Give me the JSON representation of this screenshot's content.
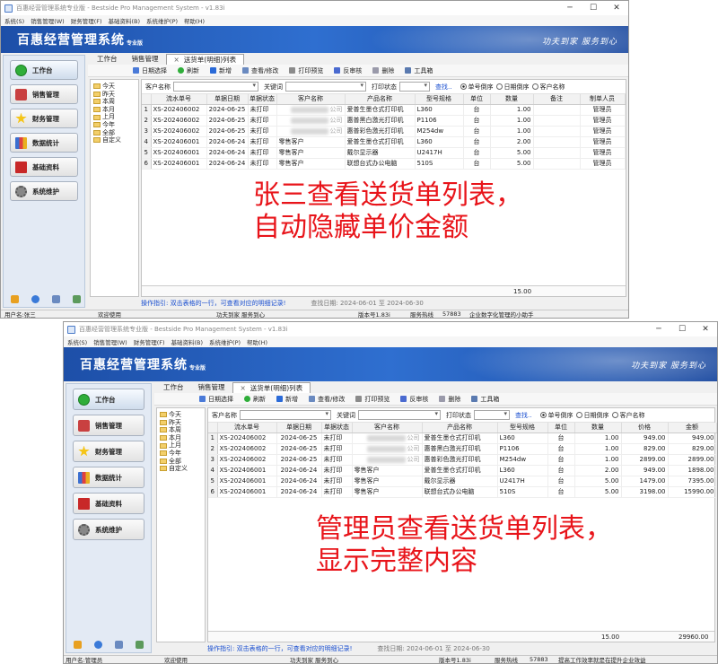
{
  "window1": {
    "title": "百惠经营管理系统专业版 - Bestside Pro Management System - v1.83i",
    "menu": [
      "系统(S)",
      "销售管理(W)",
      "财务管理(F)",
      "基础资料(B)",
      "系统维护(P)",
      "帮助(H)"
    ],
    "app_title": "百惠经营管理系统",
    "app_sub": "专业版",
    "slogan": "功夫到家  服务到心",
    "sidebar": [
      "工作台",
      "销售管理",
      "财务管理",
      "数据统计",
      "基础资料",
      "系统维护"
    ],
    "tabs": [
      "工作台",
      "销售管理",
      "送货单(明细)列表"
    ],
    "toolbar": [
      "日期选择",
      "刷新",
      "新增",
      "查看/修改",
      "打印预览",
      "反审核",
      "删除",
      "工具箱"
    ],
    "tree": [
      "今天",
      "昨天",
      "本周",
      "本月",
      "上月",
      "今年",
      "全部",
      "自定义"
    ],
    "filter": {
      "customer_label": "客户名称",
      "keyword_label": "关键词",
      "print_label": "打印状态",
      "search": "查找..",
      "radio": [
        "单号倒序",
        "日期倒序",
        "客户名称"
      ]
    },
    "columns": [
      "流水单号",
      "单据日期",
      "单据状态",
      "客户名称",
      "产品名称",
      "型号规格",
      "单位",
      "数量",
      "备注",
      "制单人员"
    ],
    "rows": [
      [
        "1",
        "XS-202406002",
        "2024-06-25",
        "未打印",
        "公司",
        "爱普生墨仓式打印机",
        "L360",
        "台",
        "1.00",
        "",
        "管理员"
      ],
      [
        "2",
        "XS-202406002",
        "2024-06-25",
        "未打印",
        "公司",
        "惠普黑白激光打印机",
        "P1106",
        "台",
        "1.00",
        "",
        "管理员"
      ],
      [
        "3",
        "XS-202406002",
        "2024-06-25",
        "未打印",
        "公司",
        "惠普彩色激光打印机",
        "M254dw",
        "台",
        "1.00",
        "",
        "管理员"
      ],
      [
        "4",
        "XS-202406001",
        "2024-06-24",
        "未打印",
        "零售客户",
        "爱普生墨仓式打印机",
        "L360",
        "台",
        "2.00",
        "",
        "管理员"
      ],
      [
        "5",
        "XS-202406001",
        "2024-06-24",
        "未打印",
        "零售客户",
        "戴尔显示器",
        "U2417H",
        "台",
        "5.00",
        "",
        "管理员"
      ],
      [
        "6",
        "XS-202406001",
        "2024-06-24",
        "未打印",
        "零售客户",
        "联想台式办公电脑",
        "510S",
        "台",
        "5.00",
        "",
        "管理员"
      ]
    ],
    "total_qty": "15.00",
    "guide": "操作指引: 双击表格的一行，可查看对应的明细记录!",
    "date_range": "查找日期: 2024-06-01 至 2024-06-30",
    "status": {
      "user": "用户名:张三",
      "welcome": "欢迎使用",
      "motto": "功夫到家 服务到心",
      "version": "版本号1.83i",
      "service": "服务热线",
      "phone": "57883",
      "tip": "企业数字化管理的小助手"
    },
    "annotation": [
      "张三查看送货单列表，",
      "自动隐藏单价金额"
    ]
  },
  "window2": {
    "title": "百惠经营管理系统专业版 - Bestside Pro Management System - v1.83i",
    "menu": [
      "系统(S)",
      "销售管理(W)",
      "财务管理(F)",
      "基础资料(B)",
      "系统维护(P)",
      "帮助(H)"
    ],
    "app_title": "百惠经营管理系统",
    "app_sub": "专业版",
    "slogan": "功夫到家  服务到心",
    "sidebar": [
      "工作台",
      "销售管理",
      "财务管理",
      "数据统计",
      "基础资料",
      "系统维护"
    ],
    "tabs": [
      "工作台",
      "销售管理",
      "送货单(明细)列表"
    ],
    "toolbar": [
      "日期选择",
      "刷新",
      "新增",
      "查看/修改",
      "打印预览",
      "反审核",
      "删除",
      "工具箱"
    ],
    "tree": [
      "今天",
      "昨天",
      "本周",
      "本月",
      "上月",
      "今年",
      "全部",
      "自定义"
    ],
    "filter": {
      "customer_label": "客户名称",
      "keyword_label": "关键词",
      "print_label": "打印状态",
      "search": "查找..",
      "radio": [
        "单号倒序",
        "日期倒序",
        "客户名称"
      ]
    },
    "columns": [
      "流水单号",
      "单据日期",
      "单据状态",
      "客户名称",
      "产品名称",
      "型号规格",
      "单位",
      "数量",
      "价格",
      "金额"
    ],
    "rows": [
      [
        "1",
        "XS-202406002",
        "2024-06-25",
        "未打印",
        "公司",
        "爱普生墨仓式打印机",
        "L360",
        "台",
        "1.00",
        "949.00",
        "949.00"
      ],
      [
        "2",
        "XS-202406002",
        "2024-06-25",
        "未打印",
        "公司",
        "惠普黑白激光打印机",
        "P1106",
        "台",
        "1.00",
        "829.00",
        "829.00"
      ],
      [
        "3",
        "XS-202406002",
        "2024-06-25",
        "未打印",
        "公司",
        "惠普彩色激光打印机",
        "M254dw",
        "台",
        "1.00",
        "2899.00",
        "2899.00"
      ],
      [
        "4",
        "XS-202406001",
        "2024-06-24",
        "未打印",
        "零售客户",
        "爱普生墨仓式打印机",
        "L360",
        "台",
        "2.00",
        "949.00",
        "1898.00"
      ],
      [
        "5",
        "XS-202406001",
        "2024-06-24",
        "未打印",
        "零售客户",
        "戴尔显示器",
        "U2417H",
        "台",
        "5.00",
        "1479.00",
        "7395.00"
      ],
      [
        "6",
        "XS-202406001",
        "2024-06-24",
        "未打印",
        "零售客户",
        "联想台式办公电脑",
        "510S",
        "台",
        "5.00",
        "3198.00",
        "15990.00"
      ]
    ],
    "total_qty": "15.00",
    "total_amount": "29960.00",
    "guide": "操作指引: 双击表格的一行，可查看对应的明细记录!",
    "date_range": "查找日期: 2024-06-01 至 2024-06-30",
    "status": {
      "user": "用户名:管理员",
      "welcome": "欢迎使用",
      "motto": "功夫到家 服务到心",
      "version": "版本号1.83i",
      "service": "服务热线",
      "phone": "57883",
      "tip": "提高工作效率就是在提升企业效益"
    },
    "annotation": [
      "管理员查看送货单列表，",
      "显示完整内容"
    ]
  }
}
